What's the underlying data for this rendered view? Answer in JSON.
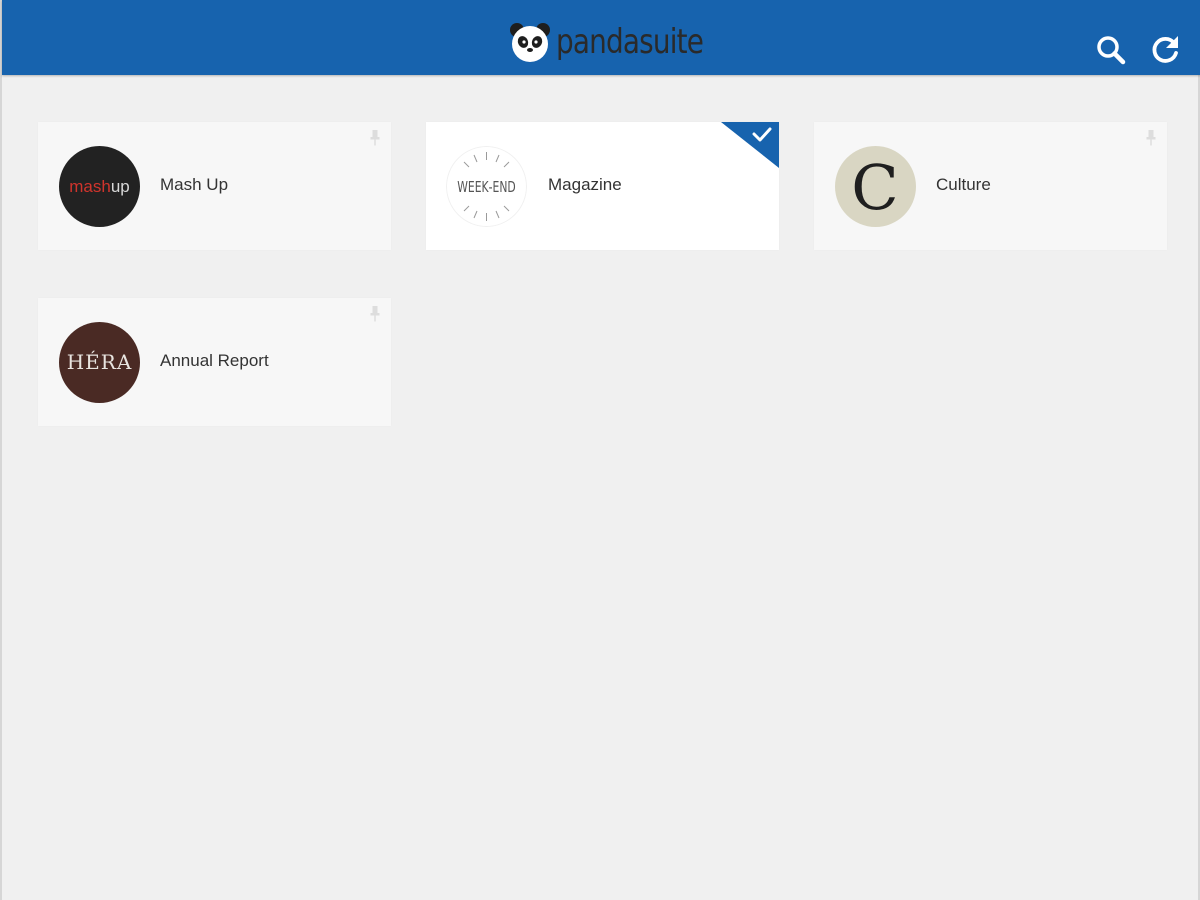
{
  "app": {
    "brand": "pandasuite",
    "colors": {
      "header": "#1763ae",
      "background": "#f0f0f0",
      "card": "#f7f7f7",
      "card_selected": "#ffffff",
      "label": "#333333",
      "accent": "#1763ae"
    }
  },
  "toolbar": {
    "search_icon": "search-icon",
    "refresh_icon": "refresh-icon"
  },
  "projects": [
    {
      "label": "Mash Up",
      "thumb_text": [
        "mash",
        "up"
      ],
      "selected": false,
      "pin_icon": "pin-icon"
    },
    {
      "label": "Magazine",
      "thumb_text": [
        "WEEK",
        "END"
      ],
      "selected": true,
      "status_icon": "check-icon"
    },
    {
      "label": "Culture",
      "thumb_text": "C",
      "selected": false,
      "pin_icon": "pin-icon"
    },
    {
      "label": "Annual Report",
      "thumb_text": "HÉRA",
      "selected": false,
      "pin_icon": "pin-icon"
    }
  ]
}
